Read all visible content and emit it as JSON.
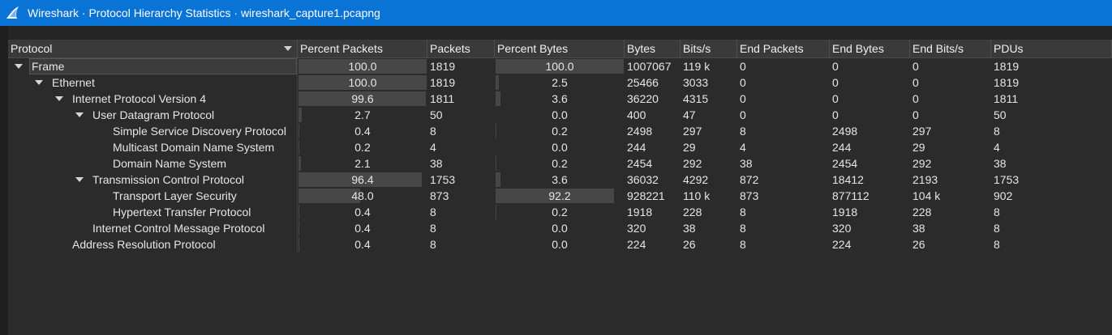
{
  "window": {
    "title": "Wireshark · Protocol Hierarchy Statistics · wireshark_capture1.pcapng",
    "icon": "wireshark-fin-icon",
    "accent_color": "#0a73d6"
  },
  "table": {
    "columns": [
      "Protocol",
      "Percent Packets",
      "Packets",
      "Percent Bytes",
      "Bytes",
      "Bits/s",
      "End Packets",
      "End Bytes",
      "End Bits/s",
      "PDUs"
    ],
    "rows": [
      {
        "protocol": "Frame",
        "expanded": true,
        "percent_packets": "100.0",
        "packets": "1819",
        "percent_bytes": "100.0",
        "bytes": "1007067",
        "bits_s": "119 k",
        "end_packets": "0",
        "end_bytes": "0",
        "end_bits_s": "0",
        "pdus": "1819"
      },
      {
        "protocol": "Ethernet",
        "expanded": true,
        "percent_packets": "100.0",
        "packets": "1819",
        "percent_bytes": "2.5",
        "bytes": "25466",
        "bits_s": "3033",
        "end_packets": "0",
        "end_bytes": "0",
        "end_bits_s": "0",
        "pdus": "1819"
      },
      {
        "protocol": "Internet Protocol Version 4",
        "expanded": true,
        "percent_packets": "99.6",
        "packets": "1811",
        "percent_bytes": "3.6",
        "bytes": "36220",
        "bits_s": "4315",
        "end_packets": "0",
        "end_bytes": "0",
        "end_bits_s": "0",
        "pdus": "1811"
      },
      {
        "protocol": "User Datagram Protocol",
        "expanded": true,
        "percent_packets": "2.7",
        "packets": "50",
        "percent_bytes": "0.0",
        "bytes": "400",
        "bits_s": "47",
        "end_packets": "0",
        "end_bytes": "0",
        "end_bits_s": "0",
        "pdus": "50"
      },
      {
        "protocol": "Simple Service Discovery Protocol",
        "expanded": false,
        "percent_packets": "0.4",
        "packets": "8",
        "percent_bytes": "0.2",
        "bytes": "2498",
        "bits_s": "297",
        "end_packets": "8",
        "end_bytes": "2498",
        "end_bits_s": "297",
        "pdus": "8"
      },
      {
        "protocol": "Multicast Domain Name System",
        "expanded": false,
        "percent_packets": "0.2",
        "packets": "4",
        "percent_bytes": "0.0",
        "bytes": "244",
        "bits_s": "29",
        "end_packets": "4",
        "end_bytes": "244",
        "end_bits_s": "29",
        "pdus": "4"
      },
      {
        "protocol": "Domain Name System",
        "expanded": false,
        "percent_packets": "2.1",
        "packets": "38",
        "percent_bytes": "0.2",
        "bytes": "2454",
        "bits_s": "292",
        "end_packets": "38",
        "end_bytes": "2454",
        "end_bits_s": "292",
        "pdus": "38"
      },
      {
        "protocol": "Transmission Control Protocol",
        "expanded": true,
        "percent_packets": "96.4",
        "packets": "1753",
        "percent_bytes": "3.6",
        "bytes": "36032",
        "bits_s": "4292",
        "end_packets": "872",
        "end_bytes": "18412",
        "end_bits_s": "2193",
        "pdus": "1753"
      },
      {
        "protocol": "Transport Layer Security",
        "expanded": false,
        "percent_packets": "48.0",
        "packets": "873",
        "percent_bytes": "92.2",
        "bytes": "928221",
        "bits_s": "110 k",
        "end_packets": "873",
        "end_bytes": "877112",
        "end_bits_s": "104 k",
        "pdus": "902"
      },
      {
        "protocol": "Hypertext Transfer Protocol",
        "expanded": false,
        "percent_packets": "0.4",
        "packets": "8",
        "percent_bytes": "0.2",
        "bytes": "1918",
        "bits_s": "228",
        "end_packets": "8",
        "end_bytes": "1918",
        "end_bits_s": "228",
        "pdus": "8"
      },
      {
        "protocol": "Internet Control Message Protocol",
        "expanded": false,
        "percent_packets": "0.4",
        "packets": "8",
        "percent_bytes": "0.0",
        "bytes": "320",
        "bits_s": "38",
        "end_packets": "8",
        "end_bytes": "320",
        "end_bits_s": "38",
        "pdus": "8"
      },
      {
        "protocol": "Address Resolution Protocol",
        "expanded": false,
        "percent_packets": "0.4",
        "packets": "8",
        "percent_bytes": "0.0",
        "bytes": "224",
        "bits_s": "26",
        "end_packets": "8",
        "end_bytes": "224",
        "end_bits_s": "26",
        "pdus": "8"
      }
    ]
  }
}
